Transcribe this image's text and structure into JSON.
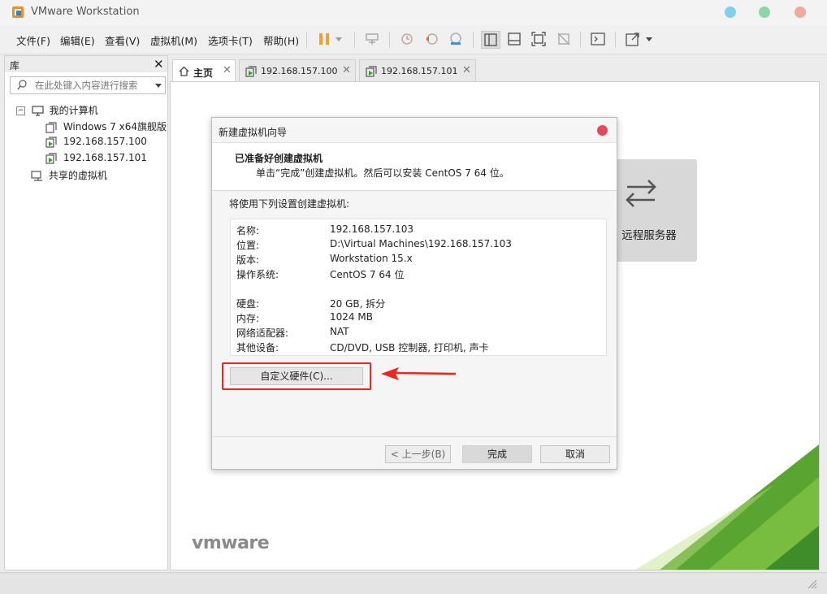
{
  "app": {
    "title": "VMware Workstation"
  },
  "menu": {
    "file": "文件(F)",
    "edit": "编辑(E)",
    "view": "查看(V)",
    "vm": "虚拟机(M)",
    "tabs": "选项卡(T)",
    "help": "帮助(H)"
  },
  "library": {
    "title": "库",
    "search_placeholder": "在此处键入内容进行搜索",
    "tree": {
      "my_computer": "我的计算机",
      "vms": [
        "Windows 7 x64旗舰版",
        "192.168.157.100",
        "192.168.157.101"
      ],
      "shared": "共享的虚拟机"
    }
  },
  "tabs": [
    "主页",
    "192.168.157.100",
    "192.168.157.101"
  ],
  "home": {
    "remote_server": "远程服务器",
    "logo": "vmware"
  },
  "dialog": {
    "title": "新建虚拟机向导",
    "heading": "已准备好创建虚拟机",
    "subheading": "单击“完成”创建虚拟机。然后可以安装 CentOS 7 64 位。",
    "intro": "将使用下列设置创建虚拟机:",
    "settings": [
      {
        "label": "名称:",
        "value": "192.168.157.103"
      },
      {
        "label": "位置:",
        "value": "D:\\Virtual Machines\\192.168.157.103"
      },
      {
        "label": "版本:",
        "value": "Workstation 15.x"
      },
      {
        "label": "操作系统:",
        "value": "CentOS 7 64 位"
      },
      {
        "label": "硬盘:",
        "value": "20 GB, 拆分"
      },
      {
        "label": "内存:",
        "value": "1024 MB"
      },
      {
        "label": "网络适配器:",
        "value": "NAT"
      },
      {
        "label": "其他设备:",
        "value": "CD/DVD, USB 控制器, 打印机, 声卡"
      }
    ],
    "customize": "自定义硬件(C)...",
    "back": "< 上一步(B)",
    "finish": "完成",
    "cancel": "取消"
  },
  "colors": {
    "annotation_red": "#e42a22",
    "close_red": "#e24a5b",
    "vmware_green": "#6ab23a"
  }
}
